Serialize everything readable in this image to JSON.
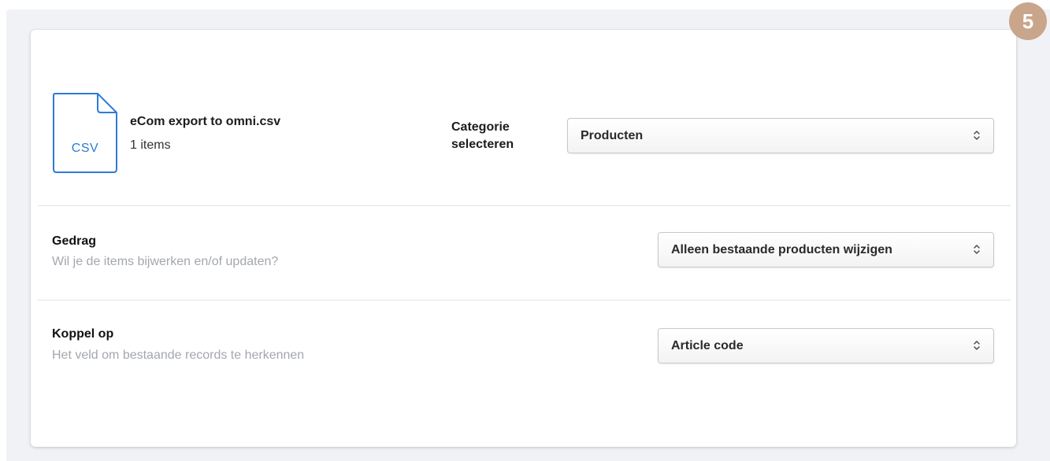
{
  "step_badge": "5",
  "file": {
    "icon": "csv-file-icon",
    "type_label": "CSV",
    "name": "eCom export to omni.csv",
    "count": "1 items"
  },
  "category": {
    "label": "Categorie selecteren",
    "selected": "Producten"
  },
  "behaviour": {
    "title": "Gedrag",
    "subtitle": "Wil je de items bijwerken en/of updaten?",
    "selected": "Alleen bestaande producten wijzigen"
  },
  "match_on": {
    "title": "Koppel op",
    "subtitle": "Het veld om bestaande records te herkennen",
    "selected": "Article code"
  },
  "colors": {
    "accent_blue": "#2d7bd3",
    "badge": "#c9a58b",
    "muted_text": "#a3a7ad"
  }
}
